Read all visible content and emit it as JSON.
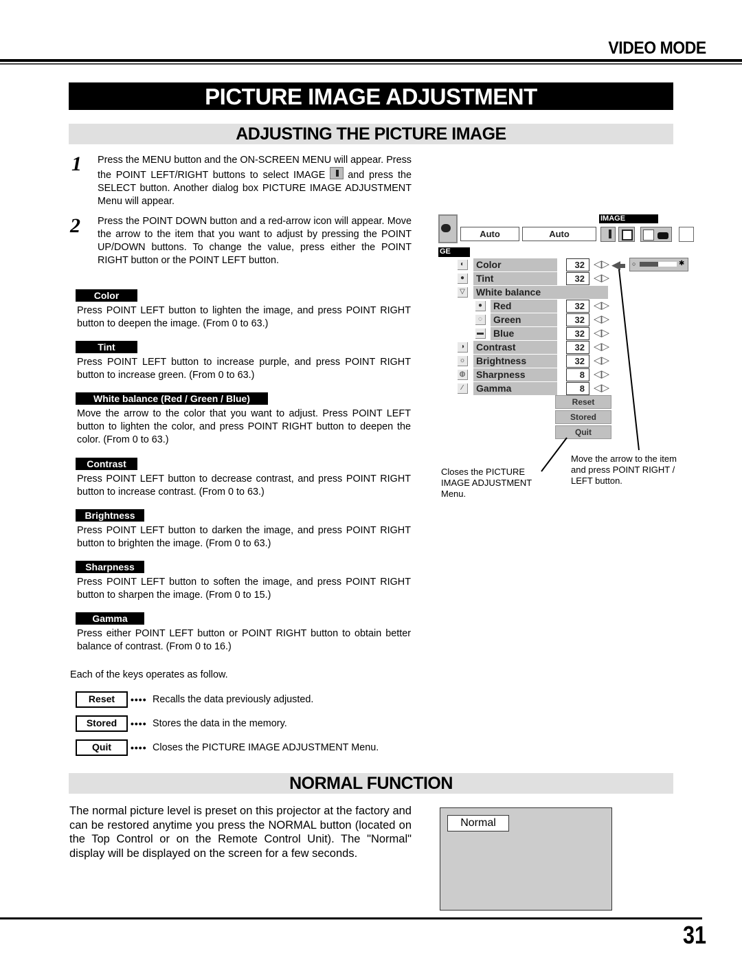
{
  "header": {
    "section": "VIDEO MODE"
  },
  "title": "PICTURE IMAGE ADJUSTMENT",
  "adjusting": {
    "heading": "ADJUSTING THE PICTURE IMAGE",
    "steps": [
      {
        "number": "1",
        "text_before_icon": "Press the MENU button and the ON-SCREEN MENU will appear.  Press the POINT LEFT/RIGHT buttons to select IMAGE",
        "icon": "image-icon",
        "text_after_icon": "and press the SELECT button.  Another dialog box PICTURE IMAGE ADJUSTMENT Menu will appear."
      },
      {
        "number": "2",
        "text": "Press the POINT DOWN button and a red-arrow icon will appear.  Move the arrow to the item that you want to adjust by pressing the POINT UP/DOWN buttons.  To change the value, press either the POINT RIGHT button or the POINT LEFT button."
      }
    ],
    "items": [
      {
        "label": "Color",
        "desc": "Press POINT LEFT button to lighten the image, and press POINT RIGHT button to deepen the image.  (From 0 to 63.)"
      },
      {
        "label": "Tint",
        "desc": "Press POINT LEFT button to increase purple, and press POINT RIGHT button to increase green.  (From 0 to 63.)"
      },
      {
        "label": "White balance (Red / Green / Blue)",
        "desc": "Move the arrow to the color that you want to adjust.  Press POINT LEFT button to lighten the color, and press POINT RIGHT button to deepen the color.  (From 0 to 63.)"
      },
      {
        "label": "Contrast",
        "desc": "Press POINT LEFT button to decrease contrast, and press POINT RIGHT button to increase contrast.  (From 0 to 63.)"
      },
      {
        "label": "Brightness",
        "desc": "Press POINT LEFT button to darken the image, and press POINT RIGHT button to brighten the image.  (From 0 to 63.)"
      },
      {
        "label": "Sharpness",
        "desc": "Press POINT LEFT button to soften the image, and press POINT RIGHT button to sharpen the image.  (From 0 to 15.)"
      },
      {
        "label": "Gamma",
        "desc": "Press either POINT LEFT button or POINT RIGHT button to obtain better balance of contrast.  (From 0 to 16.)"
      }
    ],
    "keys_intro": "Each of the keys operates as follow.",
    "keys": [
      {
        "label": "Reset",
        "dots": "••••",
        "desc": "Recalls the data previously adjusted."
      },
      {
        "label": "Stored",
        "dots": "••••",
        "desc": "Stores the data in the memory."
      },
      {
        "label": "Quit",
        "dots": "••••",
        "desc": "Closes the PICTURE IMAGE ADJUSTMENT Menu."
      }
    ]
  },
  "osd_menu": {
    "top_tag": "IMAGE",
    "left_tag": "GE",
    "auto_fields": [
      "Auto",
      "Auto"
    ],
    "rows": [
      {
        "icon": "color-icon",
        "label": "Color",
        "value": "32"
      },
      {
        "icon": "tint-icon",
        "label": "Tint",
        "value": "32"
      },
      {
        "icon": "white-balance-icon",
        "label": "White balance",
        "value": null
      },
      {
        "icon": "red-icon",
        "label": "Red",
        "value": "32",
        "sub": true
      },
      {
        "icon": "green-icon",
        "label": "Green",
        "value": "32",
        "sub": true
      },
      {
        "icon": "blue-icon",
        "label": "Blue",
        "value": "32",
        "sub": true
      },
      {
        "icon": "contrast-icon",
        "label": "Contrast",
        "value": "32"
      },
      {
        "icon": "brightness-icon",
        "label": "Brightness",
        "value": "32"
      },
      {
        "icon": "sharpness-icon",
        "label": "Sharpness",
        "value": "8"
      },
      {
        "icon": "gamma-icon",
        "label": "Gamma",
        "value": "8"
      }
    ],
    "color_slider_level": 0.5,
    "buttons": [
      "Reset",
      "Stored",
      "Quit"
    ],
    "callout_quit": "Closes the PICTURE IMAGE ADJUSTMENT Menu.",
    "callout_arrow": "Move the arrow to the item and press POINT RIGHT / LEFT button."
  },
  "normal_function": {
    "heading": "NORMAL FUNCTION",
    "text": "The normal picture level is preset on this projector at the factory and can be restored anytime you press the NORMAL button (located on the Top Control or on the Remote Control Unit).  The \"Normal\" display will be displayed on the screen for a few seconds.",
    "screen_label": "Normal"
  },
  "page_number": "31"
}
